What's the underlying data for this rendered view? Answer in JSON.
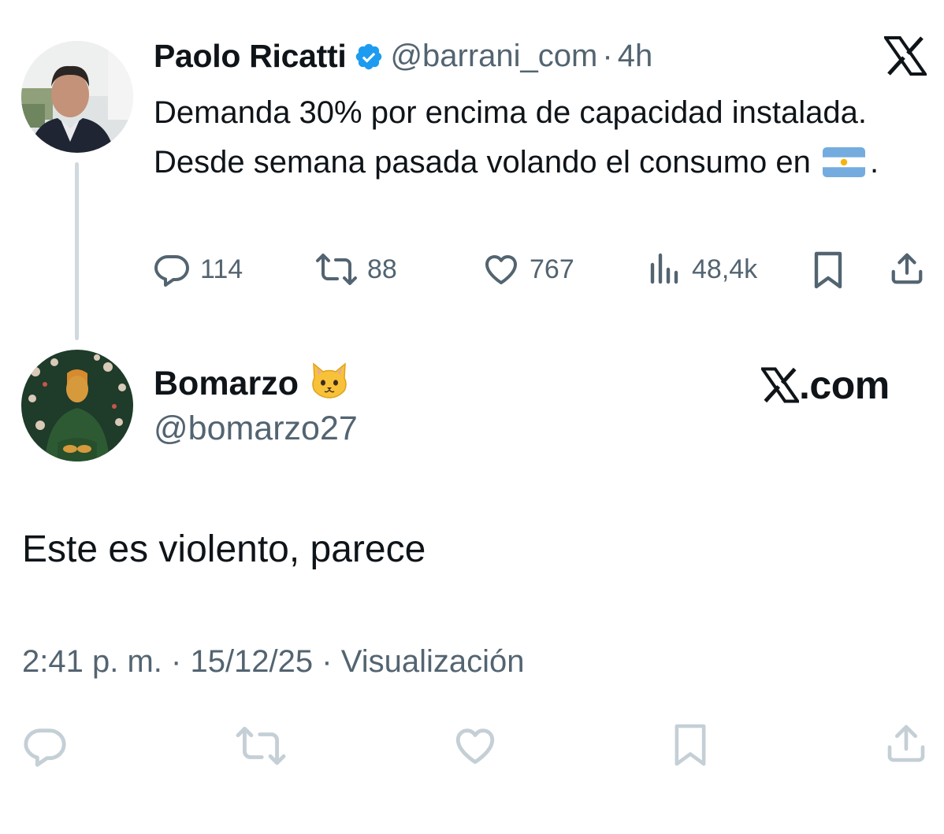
{
  "quoted_tweet": {
    "author_name": "Paolo Ricatti",
    "handle": "@barrani_com",
    "separator": "·",
    "time_ago": "4h",
    "text_before_flag": "Demanda 30% por encima de capacidad instalada. Desde semana pasada volando el consumo en",
    "text_after_flag": ".",
    "flag_icon": "argentina-flag-icon",
    "verified_color": "#1d9bf0",
    "metrics": {
      "replies": "114",
      "reposts": "88",
      "likes": "767",
      "views": "48,4k"
    }
  },
  "reply_tweet": {
    "author_name": "Bomarzo",
    "author_emoji": "cat-face-icon",
    "handle": "@bomarzo27",
    "text": "Este es violento, parece",
    "time": "2:41 p. m.",
    "date": "15/12/25",
    "views_label": "Visualización",
    "separator": "·"
  },
  "watermark": {
    "text": ".com",
    "logo": "x-logo-icon"
  },
  "colors": {
    "text_primary": "#0f1419",
    "text_secondary": "#536471",
    "thread_line": "#cfd9de",
    "faded_icons": "#c4cfd6"
  }
}
